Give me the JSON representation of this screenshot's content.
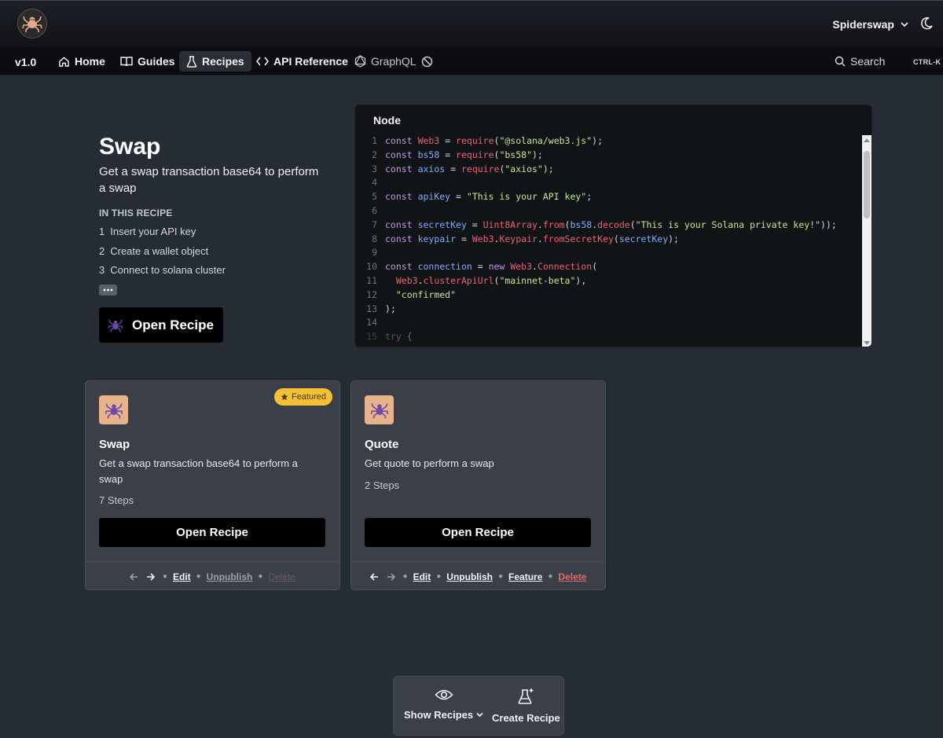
{
  "header": {
    "logo": "spider-logo-icon",
    "project_name": "Spiderswap",
    "theme_icon": "moon-icon"
  },
  "nav": {
    "version": "v1.0",
    "items": [
      {
        "label": "Home",
        "icon": "home-icon"
      },
      {
        "label": "Guides",
        "icon": "book-icon"
      },
      {
        "label": "Recipes",
        "icon": "flask-icon"
      },
      {
        "label": "API Reference",
        "icon": "code-icon"
      },
      {
        "label": "GraphQL",
        "icon": "graphql-icon"
      }
    ],
    "search_label": "Search",
    "search_shortcut": "CTRL-K"
  },
  "hero": {
    "title": "Swap",
    "description": "Get a swap transaction base64 to perform a swap",
    "section_label": "IN THIS RECIPE",
    "steps": [
      {
        "num": "1",
        "text": "Insert your API key"
      },
      {
        "num": "2",
        "text": "Create a wallet object"
      },
      {
        "num": "3",
        "text": "Connect to solana cluster"
      }
    ],
    "open_button": "Open Recipe"
  },
  "code": {
    "tab": "Node",
    "lines": [
      {
        "n": "1",
        "t": "const Web3 = require(\"@solana/web3.js\");"
      },
      {
        "n": "2",
        "t": "const bs58 = require(\"bs58\");"
      },
      {
        "n": "3",
        "t": "const axios = require(\"axios\");"
      },
      {
        "n": "4",
        "t": ""
      },
      {
        "n": "5",
        "t": "const apiKey = \"This is your API key\";"
      },
      {
        "n": "6",
        "t": ""
      },
      {
        "n": "7",
        "t": "const secretKey = Uint8Array.from(bs58.decode(\"This is your Solana private key!\"));"
      },
      {
        "n": "8",
        "t": "const keypair = Web3.Keypair.fromSecretKey(secretKey);"
      },
      {
        "n": "9",
        "t": ""
      },
      {
        "n": "10",
        "t": "const connection = new Web3.Connection("
      },
      {
        "n": "11",
        "t": "  Web3.clusterApiUrl(\"mainnet-beta\"),"
      },
      {
        "n": "12",
        "t": "  \"confirmed\""
      },
      {
        "n": "13",
        "t": ");"
      },
      {
        "n": "14",
        "t": ""
      },
      {
        "n": "15",
        "t": "try {"
      }
    ]
  },
  "cards": [
    {
      "title": "Swap",
      "description": "Get a swap transaction base64 to perform a swap",
      "steps": "7 Steps",
      "button": "Open Recipe",
      "badge": "Featured",
      "actions": {
        "edit": "Edit",
        "unpublish": "Unpublish",
        "delete": "Delete"
      }
    },
    {
      "title": "Quote",
      "description": "Get quote to perform a swap",
      "steps": "2 Steps",
      "button": "Open Recipe",
      "actions": {
        "edit": "Edit",
        "unpublish": "Unpublish",
        "feature": "Feature",
        "delete": "Delete"
      }
    }
  ],
  "toolbar": {
    "show_recipes": "Show Recipes",
    "create_recipe": "Create Recipe"
  },
  "colors": {
    "background": "#262c34",
    "featured_badge": "#f5c033",
    "card_icon_bg": "#e8b28a",
    "delete_link": "#e0686f"
  }
}
